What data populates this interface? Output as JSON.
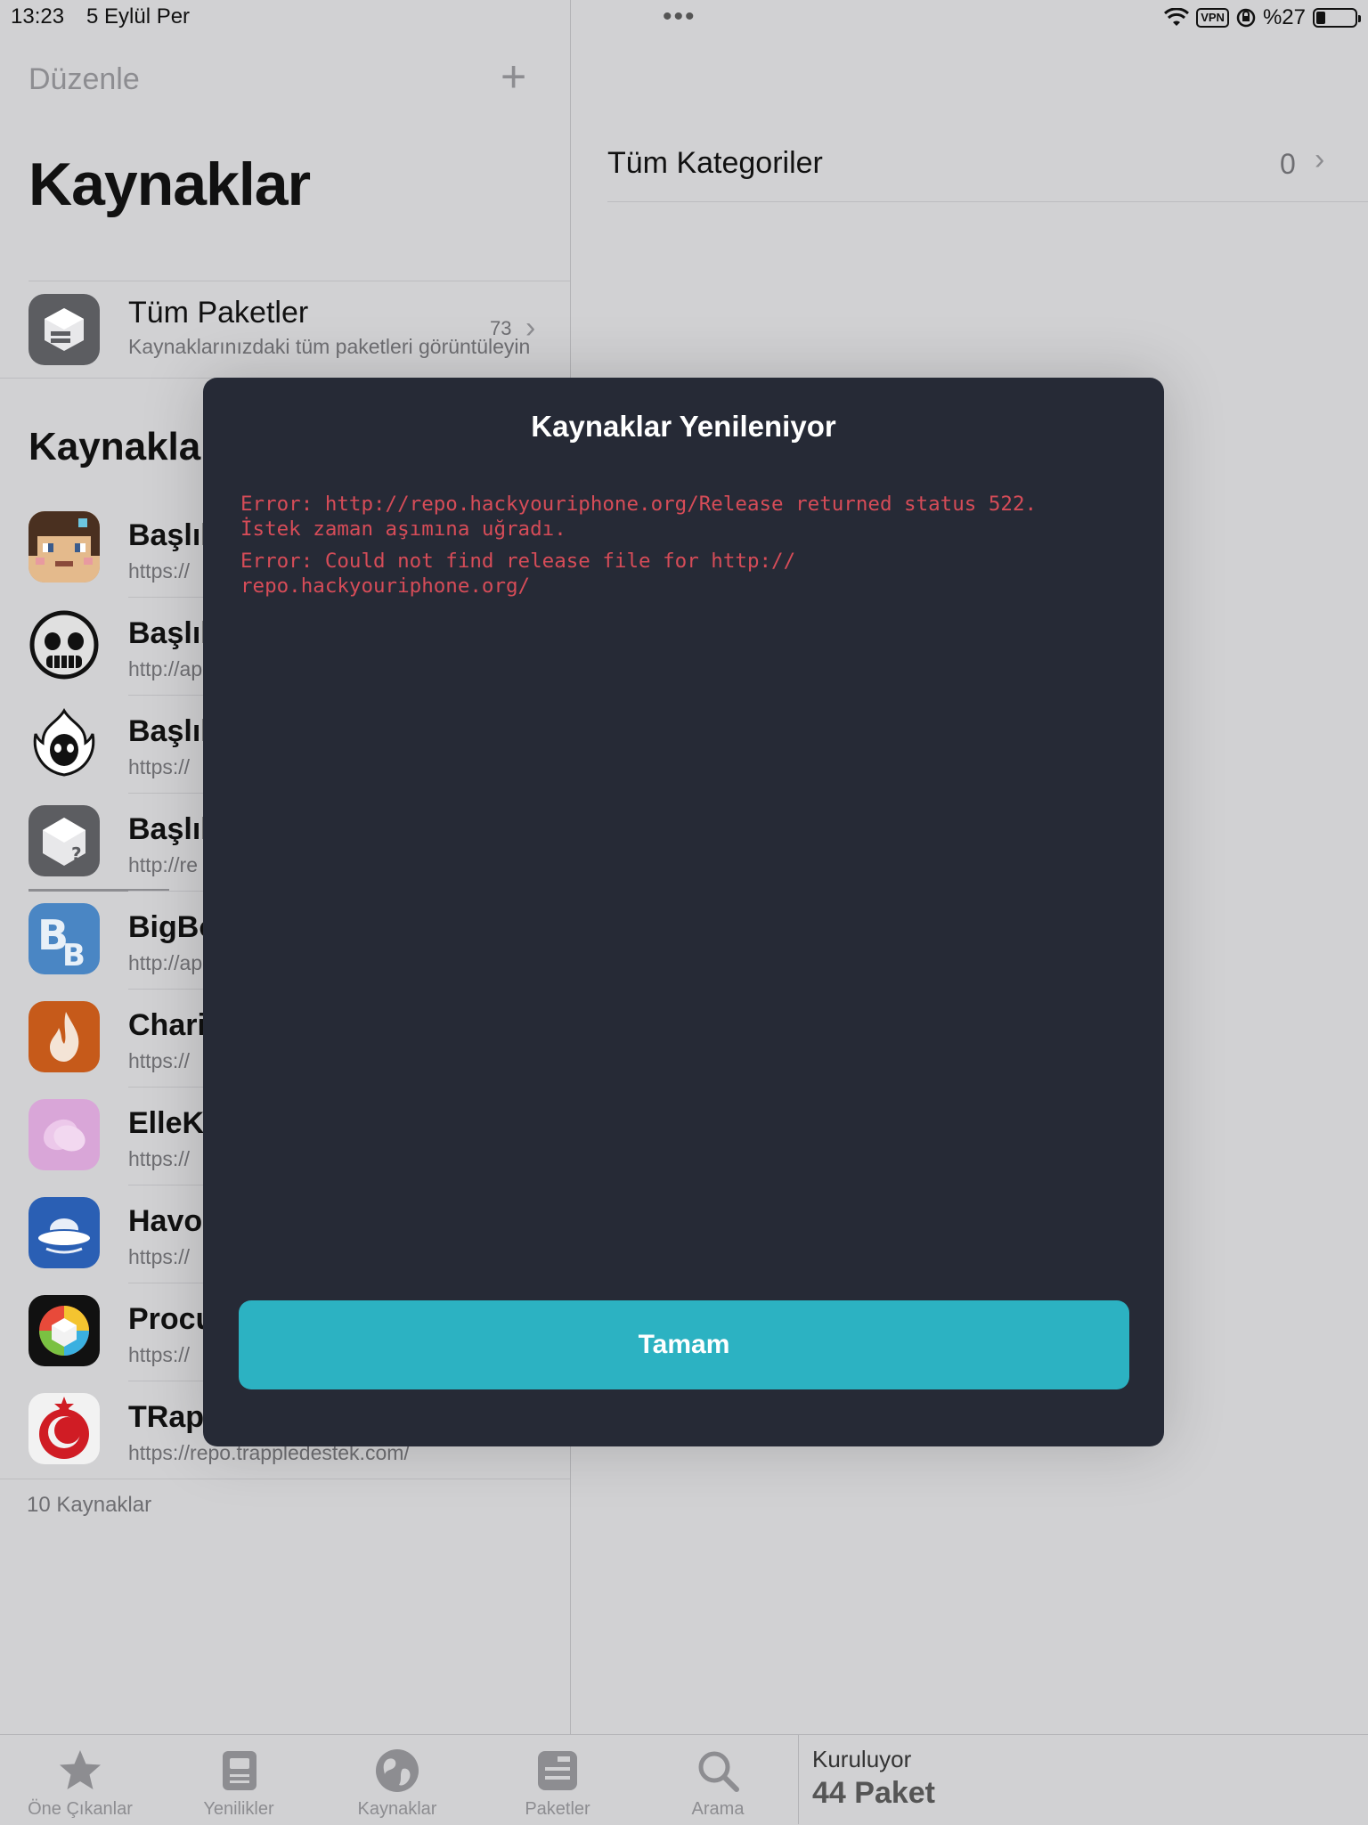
{
  "status_bar": {
    "time": "13:23",
    "date": "5 Eylül Per",
    "dots": "•••",
    "vpn": "VPN",
    "battery": "%27"
  },
  "sidebar": {
    "edit_label": "Düzenle",
    "add_label": "+",
    "large_title": "Kaynaklar",
    "all_packages": {
      "title": "Tüm Paketler",
      "subtitle": "Kaynaklarınızdaki tüm paketleri görüntüleyin",
      "count": "73"
    },
    "section_title": "Kaynaklar",
    "repos": [
      {
        "title": "Başlık",
        "subtitle": "https://",
        "icon": "pixel-character-icon"
      },
      {
        "title": "Başlık",
        "subtitle": "http://ap",
        "icon": "skull-face-icon"
      },
      {
        "title": "Başlık",
        "subtitle": "https://",
        "icon": "flame-skull-icon"
      },
      {
        "title": "Başlık",
        "subtitle": "http://re",
        "icon": "package-question-icon"
      },
      {
        "title": "BigBo",
        "subtitle": "http://ap",
        "icon": "bb-letters-icon"
      },
      {
        "title": "Chari",
        "subtitle": "https://",
        "icon": "flame-icon"
      },
      {
        "title": "ElleKi",
        "subtitle": "https://",
        "icon": "petal-icon"
      },
      {
        "title": "Havoc",
        "subtitle": "https://",
        "icon": "ufo-icon"
      },
      {
        "title": "Procu",
        "subtitle": "https://",
        "icon": "rainbow-cube-icon"
      },
      {
        "title": "TRap",
        "subtitle": "https://repo.trappledestek.com/",
        "icon": "crescent-star-icon"
      }
    ],
    "footer": "10 Kaynaklar"
  },
  "detail": {
    "title": "Tüm Kategoriler",
    "count": "0"
  },
  "modal": {
    "title": "Kaynaklar Yenileniyor",
    "errors": [
      "Error: http://repo.hackyouriphone.org/Release returned status 522.\nİstek zaman aşımına uğradı.",
      "Error: Could not find release file for http://\nrepo.hackyouriphone.org/"
    ],
    "ok_label": "Tamam",
    "colors": {
      "background": "#262a36",
      "error_text": "#d64c58",
      "button": "#2cb2c2"
    }
  },
  "tabs": [
    {
      "label": "Öne Çıkanlar",
      "icon": "star-icon"
    },
    {
      "label": "Yenilikler",
      "icon": "newspaper-icon"
    },
    {
      "label": "Kaynaklar",
      "icon": "globe-icon"
    },
    {
      "label": "Paketler",
      "icon": "package-icon"
    },
    {
      "label": "Arama",
      "icon": "search-icon"
    }
  ],
  "install_status": {
    "label": "Kuruluyor",
    "count": "44 Paket"
  }
}
